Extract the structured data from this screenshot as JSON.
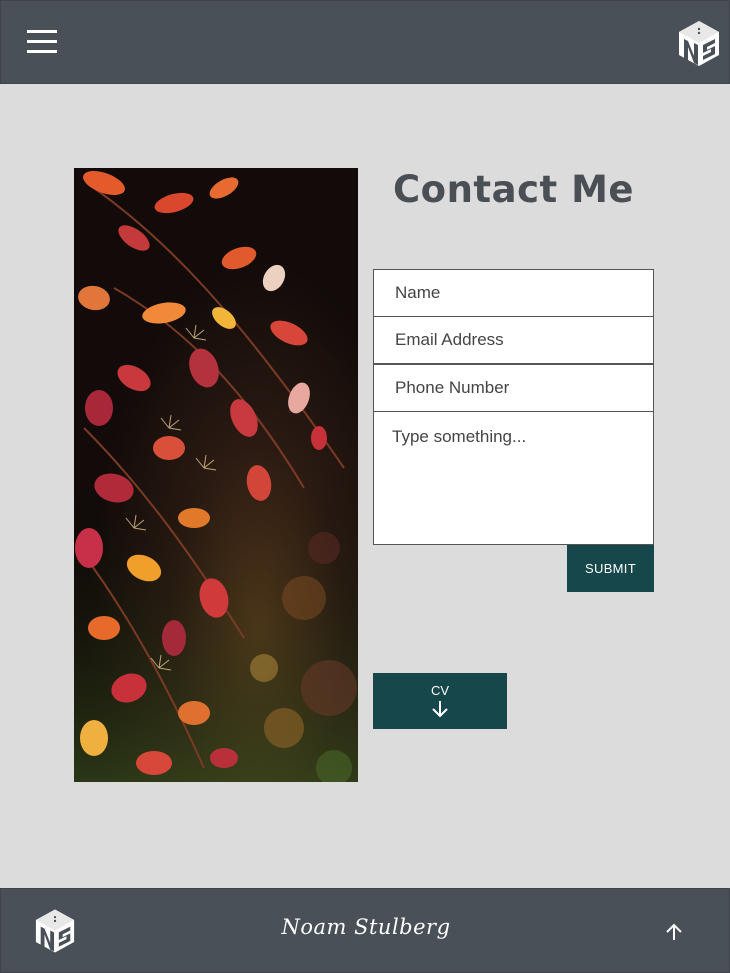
{
  "header": {
    "menu_icon": "hamburger-menu-icon",
    "logo_icon": "ns-cube-logo-icon"
  },
  "main": {
    "image": "autumn-leaves-photo",
    "title": "Contact Me",
    "form": {
      "name_placeholder": "Name",
      "email_placeholder": "Email Address",
      "phone_placeholder": "Phone Number",
      "message_placeholder": "Type something...",
      "submit_label": "SUBMIT"
    },
    "cv_button": {
      "label": "CV",
      "icon": "arrow-down-icon"
    }
  },
  "footer": {
    "logo_icon": "ns-cube-logo-icon",
    "signature": "Noam Stulberg",
    "back_to_top_icon": "arrow-up-icon"
  },
  "colors": {
    "bar": "#4a5057",
    "background": "#dcdcdc",
    "accent": "#16474a",
    "title_text": "#4a4f55"
  }
}
